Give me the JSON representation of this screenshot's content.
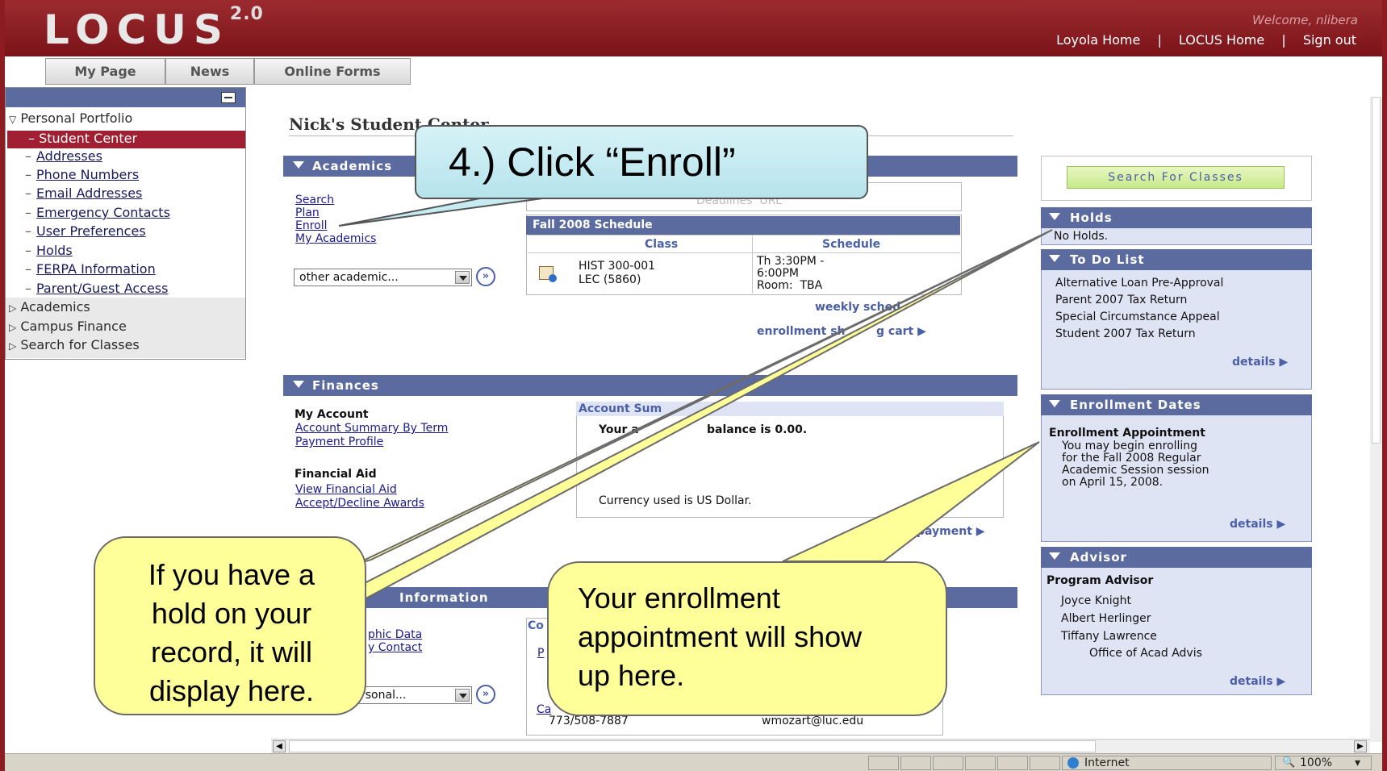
{
  "header": {
    "logo": "LOCUS",
    "version": "2.0",
    "welcome": "Welcome, nlibera",
    "links": [
      "Loyola Home",
      "LOCUS Home",
      "Sign out"
    ],
    "separator": "|"
  },
  "tabs": [
    "My Page",
    "News",
    "Online Forms"
  ],
  "sidebar": {
    "root": "Personal Portfolio",
    "active": "Student Center",
    "sub_items": [
      "Addresses",
      "Phone Numbers",
      "Email Addresses",
      "Emergency Contacts",
      "User Preferences",
      "Holds",
      "FERPA Information",
      "Parent/Guest Access"
    ],
    "sections": [
      "Academics",
      "Campus Finance",
      "Search for Classes"
    ]
  },
  "page_title": "Nick's Student Center",
  "academics": {
    "bar": "Academics",
    "links": [
      "Search",
      "Plan",
      "Enroll",
      "My Academics"
    ],
    "dropdown": "other academic...",
    "go": "»",
    "hidden_text": "Deadlines  URL",
    "schedule": {
      "title": "Fall 2008 Schedule",
      "col_class": "Class",
      "col_schedule": "Schedule",
      "class_line1": "HIST 300-001",
      "class_line2": "LEC (5860)",
      "sched_line1": "Th 3:30PM -",
      "sched_line2": "6:00PM",
      "sched_line3": "Room:  TBA"
    },
    "weekly": "weekly sched",
    "cart": "enrollment sh",
    "cart_tail": "g cart"
  },
  "finances": {
    "bar": "Finances",
    "my_account": "My Account",
    "acct_links": [
      "Account Summary By Term",
      "Payment Profile"
    ],
    "financial_aid": "Financial Aid",
    "aid_links": [
      "View Financial Aid",
      "Accept/Decline Awards"
    ],
    "summary_title": "Account Sum",
    "balance_a": "Your a",
    "balance_b": "balance is 0.00.",
    "currency": "Currency used is US Dollar.",
    "payment": "payment"
  },
  "personal": {
    "bar": "Information",
    "links_a": "phic Data",
    "links_b": "y Contact",
    "dropdown": "rsonal...",
    "go": "»",
    "contact_c": "Co",
    "contact_p": "P",
    "contact_ca": "Ca",
    "phone": "773/508-7887",
    "email": "wmozart@luc.edu"
  },
  "right": {
    "search_button": "Search For Classes",
    "holds_bar": "Holds",
    "holds_text": "No Holds.",
    "todo_bar": "To Do List",
    "todo_items": [
      "Alternative Loan Pre-Approval",
      "Parent 2007 Tax Return",
      "Special Circumstance Appeal",
      "Student 2007 Tax Return"
    ],
    "details": "details",
    "enroll_bar": "Enrollment Dates",
    "enroll_title": "Enrollment Appointment",
    "enroll_lines": [
      "You may begin enrolling",
      "for the Fall 2008 Regular",
      "Academic Session session",
      "on April 15, 2008."
    ],
    "advisor_bar": "Advisor",
    "advisor_title": "Program Advisor",
    "advisors": [
      "Joyce Knight",
      "Albert Herlinger",
      "Tiffany Lawrence"
    ],
    "advisor_office": "Office of Acad Advis"
  },
  "status": {
    "zone": "Internet",
    "zoom": "100%"
  },
  "callouts": {
    "step": "4.) Click “Enroll”",
    "holds": [
      "If you have a",
      "hold on your",
      "record, it will",
      "display here."
    ],
    "enrollment": [
      "Your enrollment",
      "appointment will show",
      "up here."
    ]
  },
  "colors": {
    "brand": "#8c1c21",
    "bar": "#5b6b9f",
    "active": "#a01f33",
    "callout": "#ffff99",
    "step": "#b6e3ec"
  }
}
